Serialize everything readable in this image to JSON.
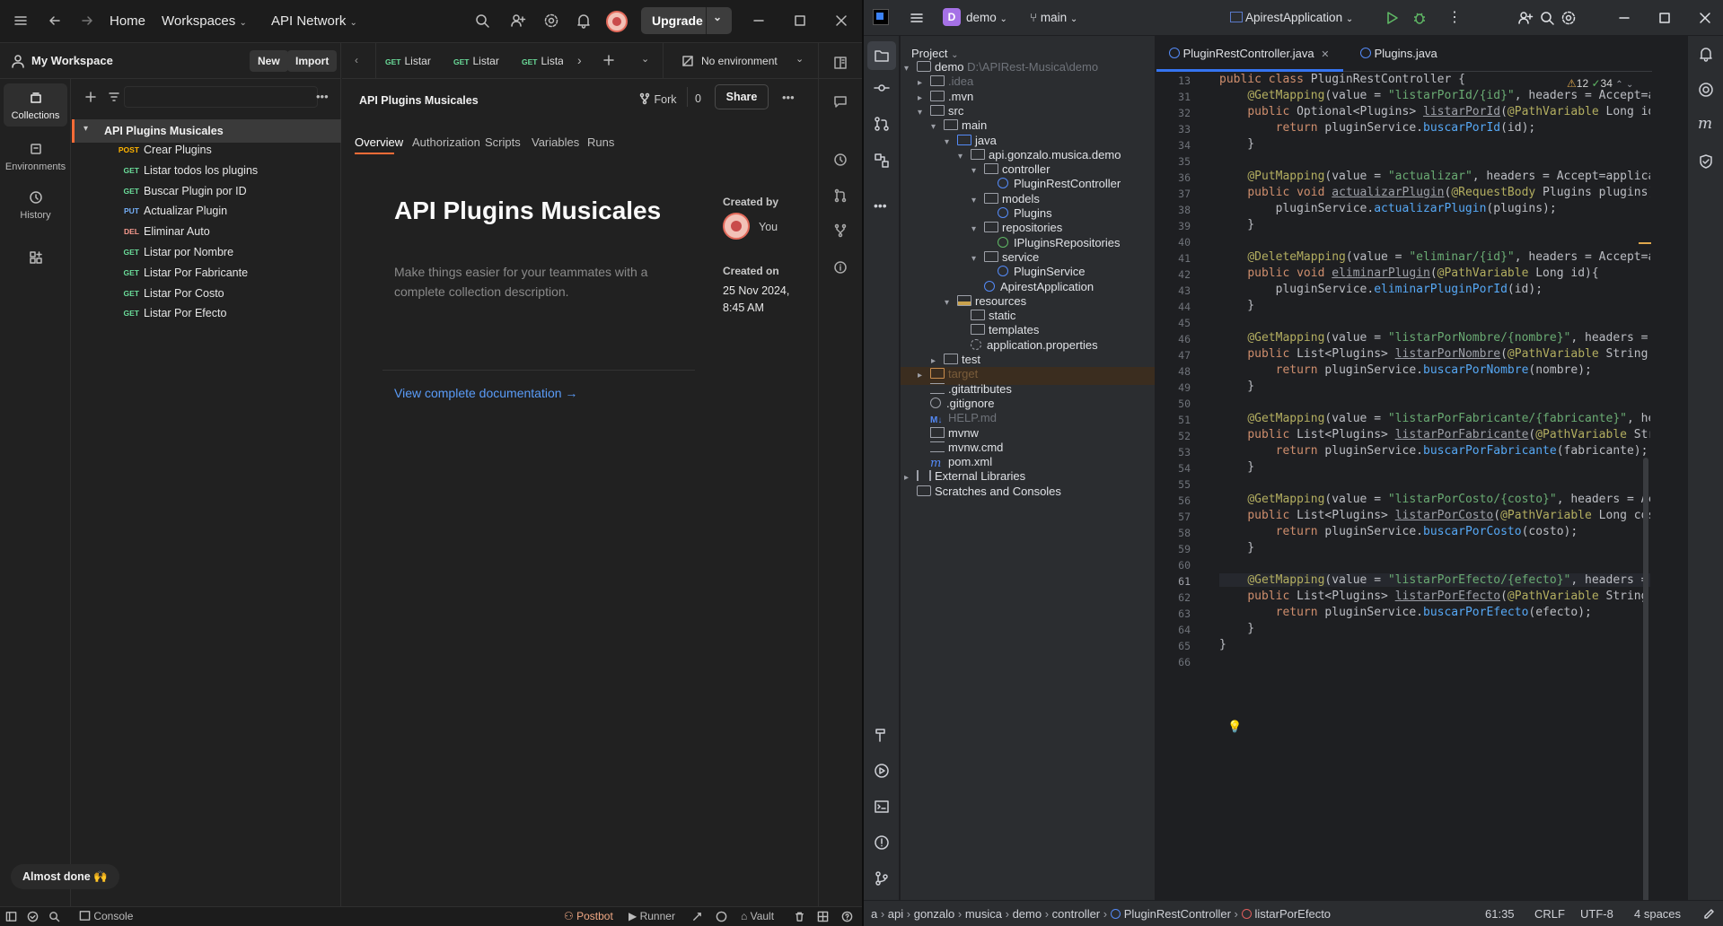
{
  "postman": {
    "topbar": {
      "home": "Home",
      "workspaces": "Workspaces",
      "api_network": "API Network",
      "upgrade": "Upgrade"
    },
    "workspace": {
      "name": "My Workspace",
      "new": "New",
      "import": "Import"
    },
    "leftnav": [
      {
        "label": "Collections",
        "icon": "collections-icon"
      },
      {
        "label": "Environments",
        "icon": "environments-icon"
      },
      {
        "label": "History",
        "icon": "history-icon"
      }
    ],
    "collection": {
      "name": "API Plugins Musicales",
      "requests": [
        {
          "method": "POST",
          "name": "Crear Plugins"
        },
        {
          "method": "GET",
          "name": "Listar todos los plugins"
        },
        {
          "method": "GET",
          "name": "Buscar Plugin por ID"
        },
        {
          "method": "PUT",
          "name": "Actualizar Plugin"
        },
        {
          "method": "DEL",
          "name": "Eliminar Auto"
        },
        {
          "method": "GET",
          "name": "Listar por Nombre"
        },
        {
          "method": "GET",
          "name": "Listar Por Fabricante"
        },
        {
          "method": "GET",
          "name": "Listar Por Costo"
        },
        {
          "method": "GET",
          "name": "Listar Por Efecto"
        }
      ]
    },
    "tabs": [
      {
        "method": "GET",
        "label": "Listar"
      },
      {
        "method": "GET",
        "label": "Listar"
      },
      {
        "method": "GET",
        "label": "Lista"
      }
    ],
    "environment": "No environment",
    "header": {
      "title": "API Plugins Musicales",
      "fork": "Fork",
      "fork_count": "0",
      "share": "Share"
    },
    "subtabs": [
      "Overview",
      "Authorization",
      "Scripts",
      "Variables",
      "Runs"
    ],
    "overview": {
      "title": "API Plugins Musicales",
      "description": "Make things easier for your teammates with a complete collection description.",
      "created_by_label": "Created by",
      "created_by": "You",
      "created_on_label": "Created on",
      "created_on": "25 Nov 2024, 8:45 AM",
      "doc_link": "View complete documentation →"
    },
    "almost_done": "Almost done 🙌",
    "statusbar": {
      "console": "Console",
      "postbot": "Postbot",
      "runner": "Runner",
      "vault": "Vault"
    }
  },
  "intellij": {
    "project": "demo",
    "branch": "main",
    "run_config": "ApirestApplication",
    "panel_title": "Project",
    "tree": [
      {
        "name": "demo",
        "extra": "D:\\APIRest-Musica\\demo",
        "depth": 0,
        "arrow": "v",
        "kind": "module"
      },
      {
        "name": ".idea",
        "depth": 1,
        "arrow": ">",
        "kind": "folder",
        "dim": true
      },
      {
        "name": ".mvn",
        "depth": 1,
        "arrow": ">",
        "kind": "folder"
      },
      {
        "name": "src",
        "depth": 1,
        "arrow": "v",
        "kind": "folder"
      },
      {
        "name": "main",
        "depth": 2,
        "arrow": "v",
        "kind": "folder"
      },
      {
        "name": "java",
        "depth": 3,
        "arrow": "v",
        "kind": "srcfolder"
      },
      {
        "name": "api.gonzalo.musica.demo",
        "depth": 4,
        "arrow": "v",
        "kind": "package"
      },
      {
        "name": "controller",
        "depth": 5,
        "arrow": "v",
        "kind": "package"
      },
      {
        "name": "PluginRestController",
        "depth": 6,
        "arrow": "",
        "kind": "class"
      },
      {
        "name": "models",
        "depth": 5,
        "arrow": "v",
        "kind": "package"
      },
      {
        "name": "Plugins",
        "depth": 6,
        "arrow": "",
        "kind": "class"
      },
      {
        "name": "repositories",
        "depth": 5,
        "arrow": "v",
        "kind": "package"
      },
      {
        "name": "IPluginsRepositories",
        "depth": 6,
        "arrow": "",
        "kind": "interface"
      },
      {
        "name": "service",
        "depth": 5,
        "arrow": "v",
        "kind": "package"
      },
      {
        "name": "PluginService",
        "depth": 6,
        "arrow": "",
        "kind": "class"
      },
      {
        "name": "ApirestApplication",
        "depth": 5,
        "arrow": "",
        "kind": "springclass"
      },
      {
        "name": "resources",
        "depth": 3,
        "arrow": "v",
        "kind": "resfolder"
      },
      {
        "name": "static",
        "depth": 4,
        "arrow": "",
        "kind": "folder"
      },
      {
        "name": "templates",
        "depth": 4,
        "arrow": "",
        "kind": "folder"
      },
      {
        "name": "application.properties",
        "depth": 4,
        "arrow": "",
        "kind": "settings"
      },
      {
        "name": "test",
        "depth": 2,
        "arrow": ">",
        "kind": "folder"
      },
      {
        "name": "target",
        "depth": 1,
        "arrow": ">",
        "kind": "excluded",
        "dim": true
      },
      {
        "name": ".gitattributes",
        "depth": 1,
        "arrow": "",
        "kind": "text"
      },
      {
        "name": ".gitignore",
        "depth": 1,
        "arrow": "",
        "kind": "ignore"
      },
      {
        "name": "HELP.md",
        "depth": 1,
        "arrow": "",
        "kind": "md",
        "dim": true
      },
      {
        "name": "mvnw",
        "depth": 1,
        "arrow": "",
        "kind": "shell"
      },
      {
        "name": "mvnw.cmd",
        "depth": 1,
        "arrow": "",
        "kind": "text"
      },
      {
        "name": "pom.xml",
        "depth": 1,
        "arrow": "",
        "kind": "maven"
      },
      {
        "name": "External Libraries",
        "depth": 0,
        "arrow": ">",
        "kind": "libs"
      },
      {
        "name": "Scratches and Consoles",
        "depth": 0,
        "arrow": "",
        "kind": "scratch"
      }
    ],
    "editor_tabs": [
      "PluginRestController.java",
      "Plugins.java"
    ],
    "inspections": {
      "warnings": "12",
      "checks": "34"
    },
    "line_numbers": [
      "13",
      "31",
      "32",
      "33",
      "34",
      "35",
      "36",
      "37",
      "38",
      "39",
      "40",
      "41",
      "42",
      "43",
      "44",
      "45",
      "46",
      "47",
      "48",
      "49",
      "50",
      "51",
      "52",
      "53",
      "54",
      "55",
      "56",
      "57",
      "58",
      "59",
      "60",
      "61",
      "62",
      "63",
      "64",
      "65",
      "66"
    ],
    "code_lines": [
      "public class PluginRestController {",
      "    @GetMapping(value = \"listarPorId/{id}\", headers = \"Accept=appl",
      "    public Optional<Plugins> listarPorId(@PathVariable Long id){",
      "        return pluginService.buscarPorId(id);",
      "    }",
      "",
      "    @PutMapping(value = \"actualizar\", headers = \"Accept=applicati",
      "    public void actualizarPlugin(@RequestBody Plugins plugins){",
      "        pluginService.actualizarPlugin(plugins);",
      "    }",
      "",
      "    @DeleteMapping(value = \"eliminar/{id}\", headers = \"Accept=appl",
      "    public void eliminarPlugin(@PathVariable Long id){",
      "        pluginService.eliminarPluginPorId(id);",
      "    }",
      "",
      "    @GetMapping(value = \"listarPorNombre/{nombre}\", headers = \"Acc",
      "    public List<Plugins> listarPorNombre(@PathVariable String nomb",
      "        return pluginService.buscarPorNombre(nombre);",
      "    }",
      "",
      "    @GetMapping(value = \"listarPorFabricante/{fabricante}\", header",
      "    public List<Plugins> listarPorFabricante(@PathVariable String",
      "        return pluginService.buscarPorFabricante(fabricante);",
      "    }",
      "",
      "    @GetMapping(value = \"listarPorCosto/{costo}\", headers = \"Accep",
      "    public List<Plugins> listarPorCosto(@PathVariable Long costo)",
      "        return pluginService.buscarPorCosto(costo);",
      "    }",
      "",
      "    @GetMapping(value = \"listarPorEfecto/{efecto}\", headers = \"Acc",
      "    public List<Plugins> listarPorEfecto(@PathVariable String efec",
      "        return pluginService.buscarPorEfecto(efecto);",
      "    }",
      "}",
      ""
    ],
    "breadcrumbs": [
      "a",
      "api",
      "gonzalo",
      "musica",
      "demo",
      "controller",
      "PluginRestController",
      "listarPorEfecto"
    ],
    "status": {
      "position": "61:35",
      "line_sep": "CRLF",
      "encoding": "UTF-8",
      "indent": "4 spaces"
    }
  }
}
